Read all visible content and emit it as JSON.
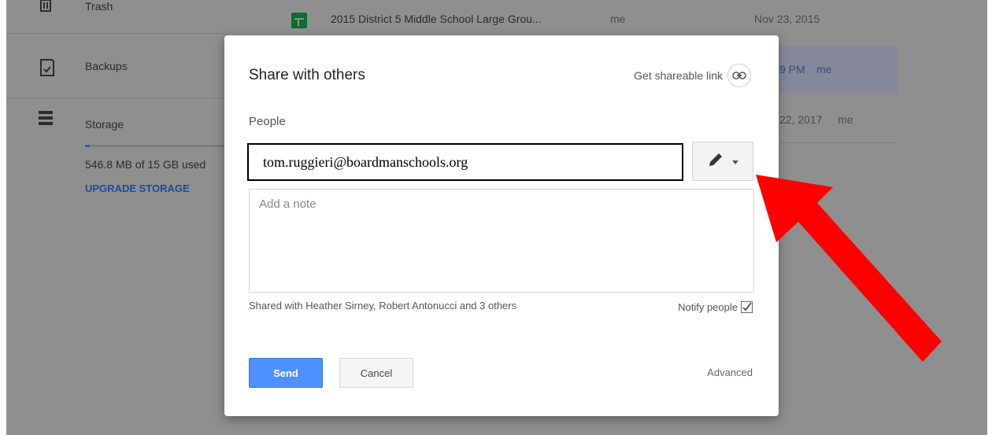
{
  "sidebar": {
    "items": [
      {
        "label": "Trash",
        "icon": "trash-icon"
      },
      {
        "label": "Backups",
        "icon": "backup-icon"
      },
      {
        "label": "Storage",
        "icon": "storage-icon"
      }
    ],
    "storage_usage": "546.8 MB of 15 GB used",
    "upgrade_label": "UPGRADE STORAGE"
  },
  "file_list": {
    "rows": [
      {
        "name": "2015 District 5 Middle School Large Grou...",
        "owner": "me",
        "modified": "Nov 23, 2015"
      },
      {
        "name": "",
        "owner": "me",
        "modified": "9 PM"
      },
      {
        "name": "",
        "owner": "me",
        "modified": "22, 2017"
      }
    ]
  },
  "dialog": {
    "title": "Share with others",
    "get_link_label": "Get shareable link",
    "people_label": "People",
    "people_value": "tom.ruggieri@boardmanschools.org",
    "note_placeholder": "Add a note",
    "shared_with": "Shared with Heather Sirney, Robert Antonucci and 3 others",
    "notify_label": "Notify people",
    "notify_checked": true,
    "send_label": "Send",
    "cancel_label": "Cancel",
    "advanced_label": "Advanced"
  },
  "colors": {
    "primary_button": "#4d90fe",
    "overlay": "#8f8f8f",
    "arrow": "#ff0000"
  }
}
